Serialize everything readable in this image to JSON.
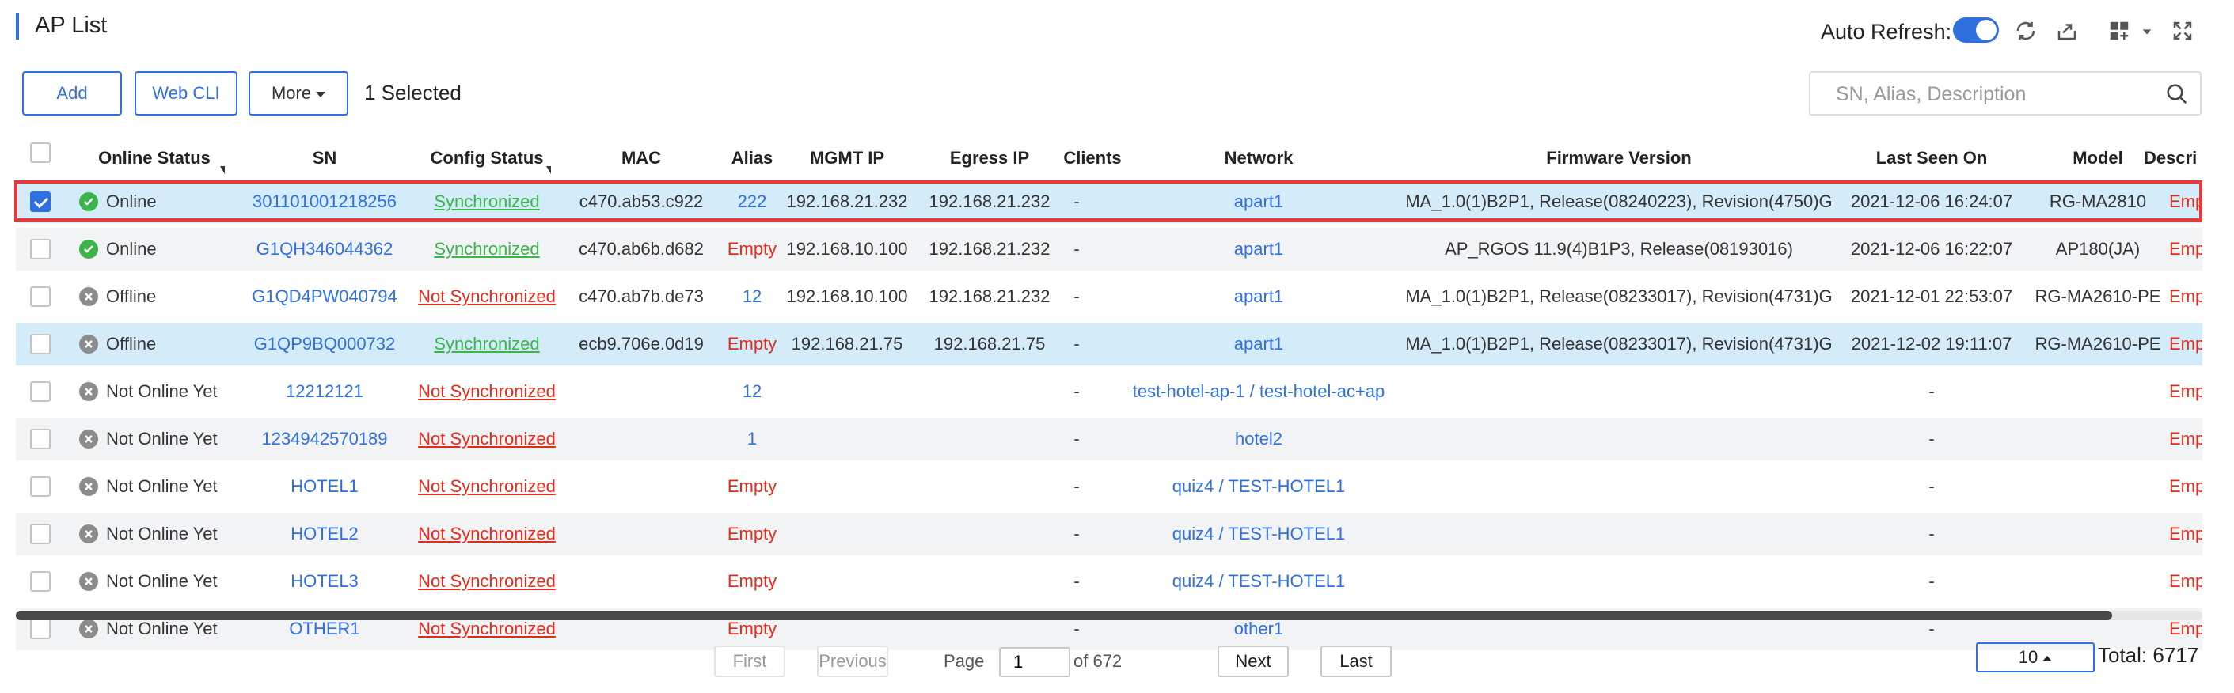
{
  "page": {
    "title": "AP List"
  },
  "header": {
    "auto_refresh_label": "Auto Refresh:",
    "auto_refresh_on": true,
    "icons": [
      "refresh-icon",
      "export-icon",
      "grid-add-icon",
      "chevron-down-icon",
      "fullscreen-icon"
    ]
  },
  "toolbar": {
    "add_label": "Add",
    "webcli_label": "Web CLI",
    "more_label": "More",
    "selected_text": "1 Selected",
    "search_placeholder": "SN, Alias, Description"
  },
  "table": {
    "columns": [
      "Online Status",
      "SN",
      "Config Status",
      "MAC",
      "Alias",
      "MGMT IP",
      "Egress IP",
      "Clients",
      "Network",
      "Firmware Version",
      "Last Seen On",
      "Model",
      "Descri"
    ],
    "rows": [
      {
        "checked": true,
        "status": "Online",
        "status_type": "online",
        "sn": "301101001218256",
        "config": "Synchronized",
        "config_type": "sync",
        "mac": "c470.ab53.c922",
        "alias": "222",
        "alias_type": "link",
        "mgmt_ip": "192.168.21.232",
        "egress_ip": "192.168.21.232",
        "clients": "-",
        "network": "apart1",
        "firmware": "MA_1.0(1)B2P1, Release(08240223), Revision(4750)G",
        "last_seen": "2021-12-06 16:24:07",
        "model": "RG-MA2810",
        "desc": "Emp"
      },
      {
        "checked": false,
        "status": "Online",
        "status_type": "online",
        "sn": "G1QH346044362",
        "config": "Synchronized",
        "config_type": "sync",
        "mac": "c470.ab6b.d682",
        "alias": "Empty",
        "alias_type": "empty",
        "mgmt_ip": "192.168.10.100",
        "egress_ip": "192.168.21.232",
        "clients": "-",
        "network": "apart1",
        "firmware": "AP_RGOS 11.9(4)B1P3, Release(08193016)",
        "last_seen": "2021-12-06 16:22:07",
        "model": "AP180(JA)",
        "desc": "Emp"
      },
      {
        "checked": false,
        "status": "Offline",
        "status_type": "offline",
        "sn": "G1QD4PW040794",
        "config": "Not Synchronized",
        "config_type": "nosync",
        "mac": "c470.ab7b.de73",
        "alias": "12",
        "alias_type": "link",
        "mgmt_ip": "192.168.10.100",
        "egress_ip": "192.168.21.232",
        "clients": "-",
        "network": "apart1",
        "firmware": "MA_1.0(1)B2P1, Release(08233017), Revision(4731)G",
        "last_seen": "2021-12-01 22:53:07",
        "model": "RG-MA2610-PE",
        "desc": "Emp"
      },
      {
        "checked": false,
        "status": "Offline",
        "status_type": "offline",
        "sn": "G1QP9BQ000732",
        "config": "Synchronized",
        "config_type": "sync",
        "mac": "ecb9.706e.0d19",
        "alias": "Empty",
        "alias_type": "empty",
        "mgmt_ip": "192.168.21.75",
        "egress_ip": "192.168.21.75",
        "clients": "-",
        "network": "apart1",
        "firmware": "MA_1.0(1)B2P1, Release(08233017), Revision(4731)G",
        "last_seen": "2021-12-02 19:11:07",
        "model": "RG-MA2610-PE",
        "desc": "Emp"
      },
      {
        "checked": false,
        "status": "Not Online Yet",
        "status_type": "offline",
        "sn": "12212121",
        "config": "Not Synchronized",
        "config_type": "nosync",
        "mac": "",
        "alias": "12",
        "alias_type": "link",
        "mgmt_ip": "",
        "egress_ip": "",
        "clients": "-",
        "network": "test-hotel-ap-1 / test-hotel-ac+ap",
        "firmware": "",
        "last_seen": "-",
        "model": "",
        "desc": "Emp"
      },
      {
        "checked": false,
        "status": "Not Online Yet",
        "status_type": "offline",
        "sn": "1234942570189",
        "config": "Not Synchronized",
        "config_type": "nosync",
        "mac": "",
        "alias": "1",
        "alias_type": "link",
        "mgmt_ip": "",
        "egress_ip": "",
        "clients": "-",
        "network": "hotel2",
        "firmware": "",
        "last_seen": "-",
        "model": "",
        "desc": "Emp"
      },
      {
        "checked": false,
        "status": "Not Online Yet",
        "status_type": "offline",
        "sn": "HOTEL1",
        "config": "Not Synchronized",
        "config_type": "nosync",
        "mac": "",
        "alias": "Empty",
        "alias_type": "empty",
        "mgmt_ip": "",
        "egress_ip": "",
        "clients": "-",
        "network": "quiz4 / TEST-HOTEL1",
        "firmware": "",
        "last_seen": "-",
        "model": "",
        "desc": "Emp"
      },
      {
        "checked": false,
        "status": "Not Online Yet",
        "status_type": "offline",
        "sn": "HOTEL2",
        "config": "Not Synchronized",
        "config_type": "nosync",
        "mac": "",
        "alias": "Empty",
        "alias_type": "empty",
        "mgmt_ip": "",
        "egress_ip": "",
        "clients": "-",
        "network": "quiz4 / TEST-HOTEL1",
        "firmware": "",
        "last_seen": "-",
        "model": "",
        "desc": "Emp"
      },
      {
        "checked": false,
        "status": "Not Online Yet",
        "status_type": "offline",
        "sn": "HOTEL3",
        "config": "Not Synchronized",
        "config_type": "nosync",
        "mac": "",
        "alias": "Empty",
        "alias_type": "empty",
        "mgmt_ip": "",
        "egress_ip": "",
        "clients": "-",
        "network": "quiz4 / TEST-HOTEL1",
        "firmware": "",
        "last_seen": "-",
        "model": "",
        "desc": "Emp"
      },
      {
        "checked": false,
        "status": "Not Online Yet",
        "status_type": "offline",
        "sn": "OTHER1",
        "config": "Not Synchronized",
        "config_type": "nosync",
        "mac": "",
        "alias": "Empty",
        "alias_type": "empty",
        "mgmt_ip": "",
        "egress_ip": "",
        "clients": "-",
        "network": "other1",
        "firmware": "",
        "last_seen": "-",
        "model": "",
        "desc": "Emp"
      }
    ]
  },
  "pagination": {
    "first_label": "First",
    "previous_label": "Previous",
    "page_label": "Page",
    "current_page": "1",
    "of_text": "of 672",
    "next_label": "Next",
    "last_label": "Last",
    "page_size": "10",
    "total_text": "Total: 6717"
  }
}
